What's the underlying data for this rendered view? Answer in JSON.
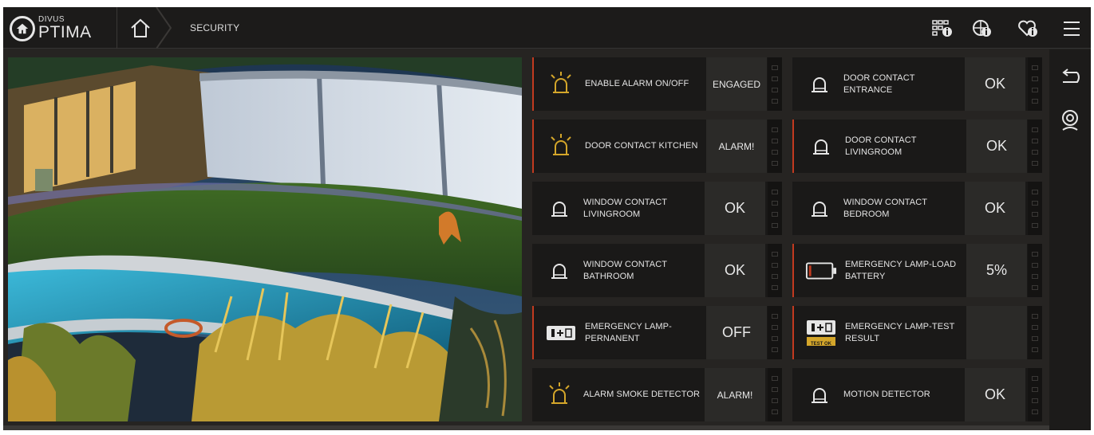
{
  "header": {
    "logo_small": "DIVUS",
    "logo_big": "PTIMA",
    "breadcrumb": "SECURITY",
    "icons": [
      "grid-info-icon",
      "globe-info-icon",
      "heart-info-icon",
      "menu-icon"
    ]
  },
  "rail": {
    "icons": [
      "back-icon",
      "location-pin-icon"
    ]
  },
  "camera": {
    "description_icon": "camera-feed"
  },
  "tiles": [
    {
      "id": "enable-alarm",
      "label": "ENABLE ALARM ON/OFF",
      "value": "ENGAGED",
      "icon": "alarm-bell-icon",
      "alert": true
    },
    {
      "id": "door-entrance",
      "label": "DOOR CONTACT ENTRANCE",
      "value": "OK",
      "icon": "bell-icon",
      "alert": false
    },
    {
      "id": "door-kitchen",
      "label": "DOOR CONTACT KITCHEN",
      "value": "ALARM!",
      "icon": "alarm-bell-icon",
      "alert": true
    },
    {
      "id": "door-livingroom",
      "label": "DOOR CONTACT LIVINGROOM",
      "value": "OK",
      "icon": "bell-icon",
      "alert": true
    },
    {
      "id": "window-livingroom",
      "label": "WINDOW CONTACT LIVINGROOM",
      "value": "OK",
      "icon": "bell-icon",
      "alert": false
    },
    {
      "id": "window-bedroom",
      "label": "WINDOW CONTACT BEDROOM",
      "value": "OK",
      "icon": "bell-icon",
      "alert": false
    },
    {
      "id": "window-bathroom",
      "label": "WINDOW CONTACT BATHROOM",
      "value": "OK",
      "icon": "bell-icon",
      "alert": false
    },
    {
      "id": "emergency-battery",
      "label": "EMERGENCY LAMP-LOAD BATTERY",
      "value": "5%",
      "icon": "battery-icon",
      "alert": true
    },
    {
      "id": "emergency-permanent",
      "label": "EMERGENCY LAMP-PERNANENT",
      "value": "OFF",
      "icon": "lamp-icon",
      "alert": true
    },
    {
      "id": "emergency-test",
      "label": "EMERGENCY LAMP-TEST RESULT",
      "value": "",
      "icon": "lamp-test-icon",
      "icon_badge": "TEST OK",
      "alert": true
    },
    {
      "id": "smoke-detector",
      "label": "ALARM SMOKE DETECTOR",
      "value": "ALARM!",
      "icon": "alarm-bell-icon",
      "alert": false
    },
    {
      "id": "motion-detector",
      "label": "MOTION DETECTOR",
      "value": "OK",
      "icon": "bell-icon",
      "alert": false
    }
  ],
  "colors": {
    "accent_alert": "#c23a1f",
    "alarm_icon": "#d4a62a",
    "panel_bg": "#1a1918"
  }
}
